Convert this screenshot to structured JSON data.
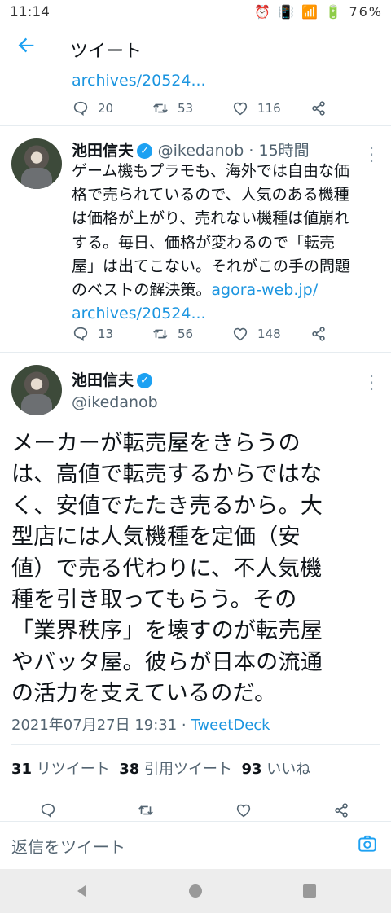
{
  "status_bar": {
    "time": "11:14",
    "icons": "⏰ 📳 📶 🔋",
    "battery": "76%"
  },
  "header": {
    "title": "ツイート"
  },
  "prev_tweet": {
    "link_tail": "archives/20524...",
    "reply_count": "20",
    "retweet_count": "53",
    "like_count": "116"
  },
  "reply_tweet": {
    "name": "池田信夫",
    "handle": "@ikedanob · 15時間",
    "text_lines": [
      "ゲーム機もプラモも、海外では自由な価",
      "格で売られているので、人気のある機種",
      "は価格が上がり、売れない機種は値崩れ",
      "する。毎日、価格が変わるので「転売",
      "屋」は出てこない。それがこの手の問題"
    ],
    "text_last": "のベストの解決策。",
    "link": "agora-web.jp/",
    "link_tail": "archives/20524...",
    "reply_count": "13",
    "retweet_count": "56",
    "like_count": "148"
  },
  "main_tweet": {
    "name": "池田信夫",
    "handle": "@ikedanob",
    "text_lines": [
      "メーカーが転売屋をきらうの",
      "は、高値で転売するからではな",
      "く、安値でたたき売るから。大",
      "型店には人気機種を定価（安",
      "値）で売る代わりに、不人気機",
      "種を引き取ってもらう。その",
      "「業界秩序」を壊すのが転売屋",
      "やバッタ屋。彼らが日本の流通",
      "の活力を支えているのだ。"
    ],
    "timestamp": "2021年07月27日 19:31 · ",
    "source": "TweetDeck",
    "retweets_num": "31",
    "retweets_label": "リツイート",
    "quotes_num": "38",
    "quotes_label": "引用ツイート",
    "likes_num": "93",
    "likes_label": "いいね"
  },
  "reply_bar": {
    "placeholder": "返信をツイート"
  },
  "icons": {
    "back": "arrow-left-icon",
    "reply": "comment-icon",
    "retweet": "retweet-icon",
    "like": "heart-icon",
    "share": "share-icon",
    "camera": "camera-icon",
    "verified": "verified-badge-icon"
  },
  "colors": {
    "accent": "#1da1f2",
    "link": "#1b95e0",
    "muted": "#536471"
  }
}
